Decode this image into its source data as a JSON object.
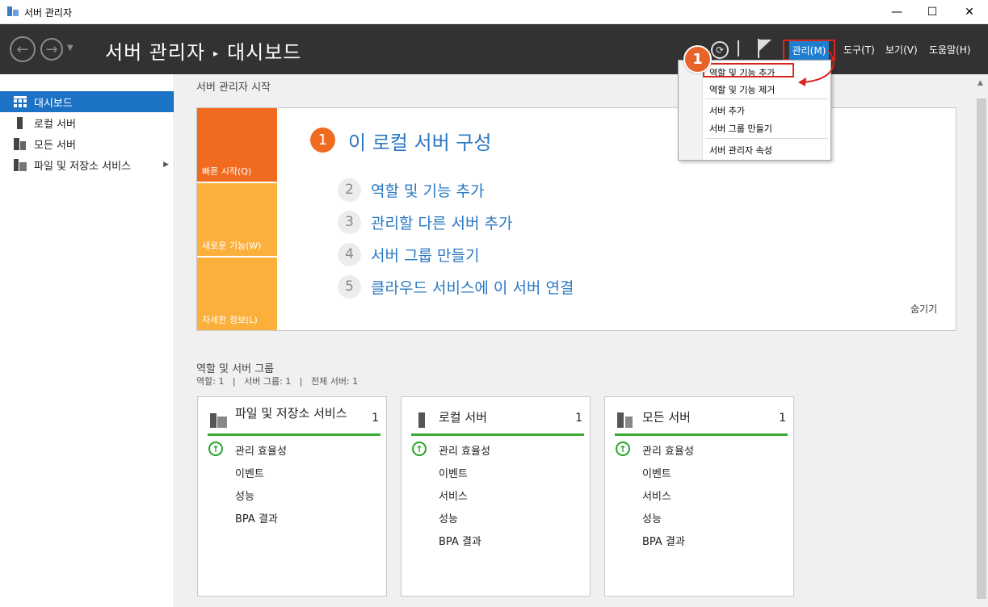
{
  "window": {
    "title": "서버 관리자",
    "minimize": "—",
    "maximize": "☐",
    "close": "✕"
  },
  "header": {
    "title_app": "서버 관리자",
    "title_arrow": "▸",
    "title_page": "대시보드",
    "menus": {
      "manage": "관리(M)",
      "tools": "도구(T)",
      "view": "보기(V)",
      "help": "도움말(H)"
    }
  },
  "sidebar": {
    "items": [
      {
        "label": "대시보드",
        "icon": "dashboard-icon"
      },
      {
        "label": "로컬 서버",
        "icon": "server-icon"
      },
      {
        "label": "모든 서버",
        "icon": "servers-icon"
      },
      {
        "label": "파일 및 저장소 서비스",
        "icon": "file-services-icon"
      }
    ]
  },
  "welcome": {
    "section_title": "서버 관리자 시작",
    "tiles": {
      "quick_start": "빠른 시작(Q)",
      "whats_new": "새로운 기능(W)",
      "learn_more": "자세한 정보(L)"
    },
    "step1": {
      "num": "1",
      "label": "이 로컬 서버 구성"
    },
    "steps": [
      {
        "num": "2",
        "label": "역할 및 기능 추가"
      },
      {
        "num": "3",
        "label": "관리할 다른 서버 추가"
      },
      {
        "num": "4",
        "label": "서버 그룹 만들기"
      },
      {
        "num": "5",
        "label": "클라우드 서비스에 이 서버 연결"
      }
    ],
    "hide": "숨기기"
  },
  "roles": {
    "section_title": "역할 및 서버 그룹",
    "summary": "역할: 1   |   서버 그룹: 1   |   전체 서버: 1",
    "cards": [
      {
        "title": "파일 및 저장소 서비스",
        "count": "1",
        "rows": [
          "관리 효율성",
          "이벤트",
          "성능",
          "BPA 결과"
        ]
      },
      {
        "title": "로컬 서버",
        "count": "1",
        "rows": [
          "관리 효율성",
          "이벤트",
          "서비스",
          "성능",
          "BPA 결과"
        ]
      },
      {
        "title": "모든 서버",
        "count": "1",
        "rows": [
          "관리 효율성",
          "이벤트",
          "서비스",
          "성능",
          "BPA 결과"
        ]
      }
    ]
  },
  "dropdown": {
    "items": [
      "역할 및 기능 추가",
      "역할 및 기능 제거",
      "서버 추가",
      "서버 그룹 만들기",
      "서버 관리자 속성"
    ]
  },
  "annotation": {
    "badge": "1"
  },
  "colors": {
    "accent": "#1c72c4",
    "header_bg": "#323232",
    "tile_orange": "#f06b1f",
    "tile_yellow": "#fbb03b",
    "ok_green": "#3aaa35",
    "callout_red": "#d9261c"
  }
}
